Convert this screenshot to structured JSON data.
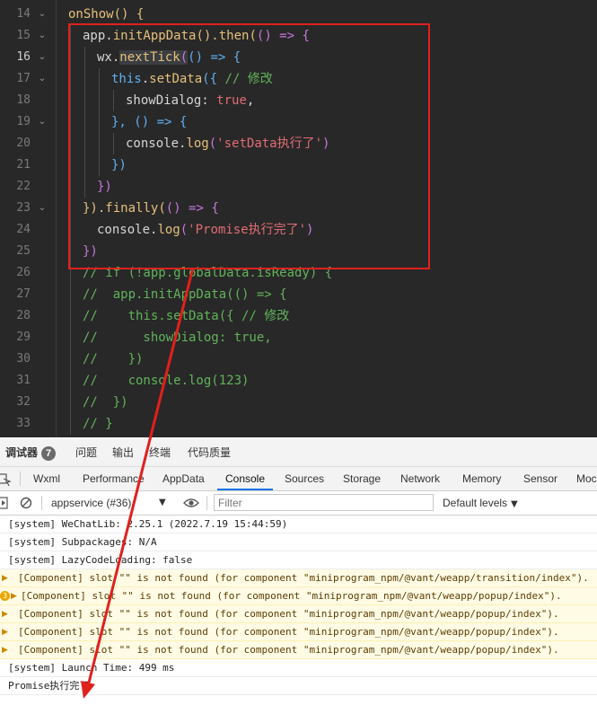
{
  "editor": {
    "lines": [
      {
        "n": "14",
        "fold": true
      },
      {
        "n": "15",
        "fold": true
      },
      {
        "n": "16",
        "fold": true,
        "current": true
      },
      {
        "n": "17",
        "fold": true
      },
      {
        "n": "18"
      },
      {
        "n": "19",
        "fold": true
      },
      {
        "n": "20"
      },
      {
        "n": "21"
      },
      {
        "n": "22"
      },
      {
        "n": "23",
        "fold": true
      },
      {
        "n": "24"
      },
      {
        "n": "25"
      },
      {
        "n": "26"
      },
      {
        "n": "27"
      },
      {
        "n": "28"
      },
      {
        "n": "29"
      },
      {
        "n": "30"
      },
      {
        "n": "31"
      },
      {
        "n": "32"
      },
      {
        "n": "33"
      }
    ],
    "code": {
      "l14": [
        "onShow",
        "() {"
      ],
      "l15": [
        "app.",
        "initAppData",
        "().",
        "then",
        "(",
        "() => {"
      ],
      "l16": [
        "wx.",
        "nextTick",
        "(",
        "() => {"
      ],
      "l17": [
        "this",
        ".",
        "setData",
        "({ ",
        "// 修改"
      ],
      "l18": [
        "showDialog: ",
        "true",
        ","
      ],
      "l19": [
        "}, ",
        "() => {"
      ],
      "l20": [
        "console.",
        "log",
        "(",
        "'setData执行了'",
        ")"
      ],
      "l21": [
        "})"
      ],
      "l22": [
        "})"
      ],
      "l23": [
        "}).",
        "finally",
        "(",
        "() => {"
      ],
      "l24": [
        "console.",
        "log",
        "(",
        "'Promise执行完了'",
        ")"
      ],
      "l25": [
        "})"
      ],
      "l26": "// if (!app.globalData.isReady) {",
      "l27": "//  app.initAppData(() => {",
      "l28": "//    this.setData({ // 修改",
      "l29": "//      showDialog: true,",
      "l30": "//    })",
      "l31": "//    console.log(123)",
      "l32": "//  })",
      "l33": "// }"
    },
    "annotation_color": "#e0201d"
  },
  "devtools": {
    "top_tabs": [
      {
        "label": "调试器",
        "badge": "7"
      },
      {
        "label": "问题"
      },
      {
        "label": "输出"
      },
      {
        "label": "终端"
      },
      {
        "label": "代码质量"
      }
    ],
    "panel_tabs": [
      "Wxml",
      "Performance",
      "AppData",
      "Console",
      "Sources",
      "Storage",
      "Network",
      "Memory",
      "Sensor",
      "Moc"
    ],
    "active_panel_tab": "Console",
    "toolbar": {
      "context": "appservice (#36)",
      "filter_placeholder": "Filter",
      "levels": "Default levels"
    },
    "console_rows": [
      {
        "type": "info",
        "text": "[system] WeChatLib: 2.25.1 (2022.7.19 15:44:59)"
      },
      {
        "type": "info",
        "text": "[system] Subpackages: N/A"
      },
      {
        "type": "info",
        "text": "[system] LazyCodeLoading: false"
      },
      {
        "type": "warn",
        "text": "[Component] slot \"\" is not found (for component \"miniprogram_npm/@vant/weapp/transition/index\")."
      },
      {
        "type": "warn",
        "count": "3",
        "text": "[Component] slot \"\" is not found (for component \"miniprogram_npm/@vant/weapp/popup/index\")."
      },
      {
        "type": "warn",
        "text": "[Component] slot \"\" is not found (for component \"miniprogram_npm/@vant/weapp/popup/index\")."
      },
      {
        "type": "warn",
        "text": "[Component] slot \"\" is not found (for component \"miniprogram_npm/@vant/weapp/popup/index\")."
      },
      {
        "type": "warn",
        "text": "[Component] slot \"\" is not found (for component \"miniprogram_npm/@vant/weapp/popup/index\")."
      },
      {
        "type": "info",
        "text": "[system] Launch Time: 499 ms"
      },
      {
        "type": "log",
        "text": "Promise执行完了"
      }
    ]
  }
}
